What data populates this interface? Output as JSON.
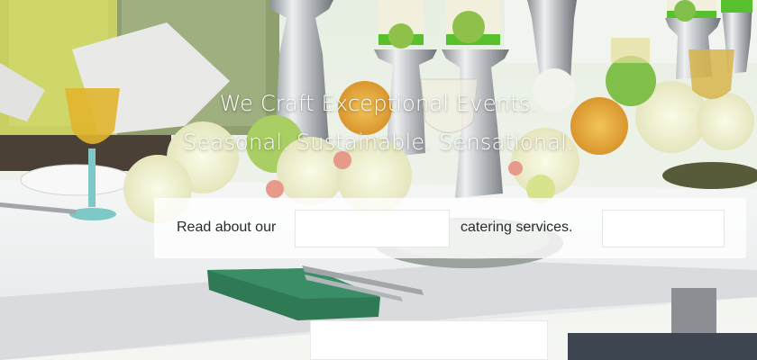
{
  "hero": {
    "headline_line1": "We Craft Exceptional Events.",
    "headline_line2": "Seasonal. Sustainable. Sensational."
  },
  "cta": {
    "text_before": "Read about our",
    "text_after": "catering services.",
    "dropdown_value": "",
    "second_dropdown_value": ""
  },
  "bottom_button": {
    "label": ""
  },
  "colors": {
    "overlay": "#ffffff",
    "text": "#2a2a2a",
    "napkin_green": "#2f7a55",
    "hydrangea_cream": "#efeecb",
    "silver": "#b8bcc0"
  }
}
